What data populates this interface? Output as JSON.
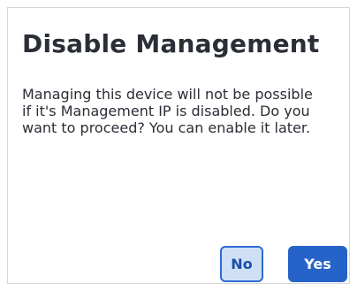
{
  "dialog": {
    "title": "Disable Management",
    "message": "Managing this device will not be possible if it's Management IP is disabled. Do you want to proceed? You can enable it later.",
    "no_label": "No",
    "yes_label": "Yes"
  },
  "colors": {
    "primary": "#2563c9",
    "secondary_bg": "#cfe0f6",
    "text": "#2a2e36"
  }
}
